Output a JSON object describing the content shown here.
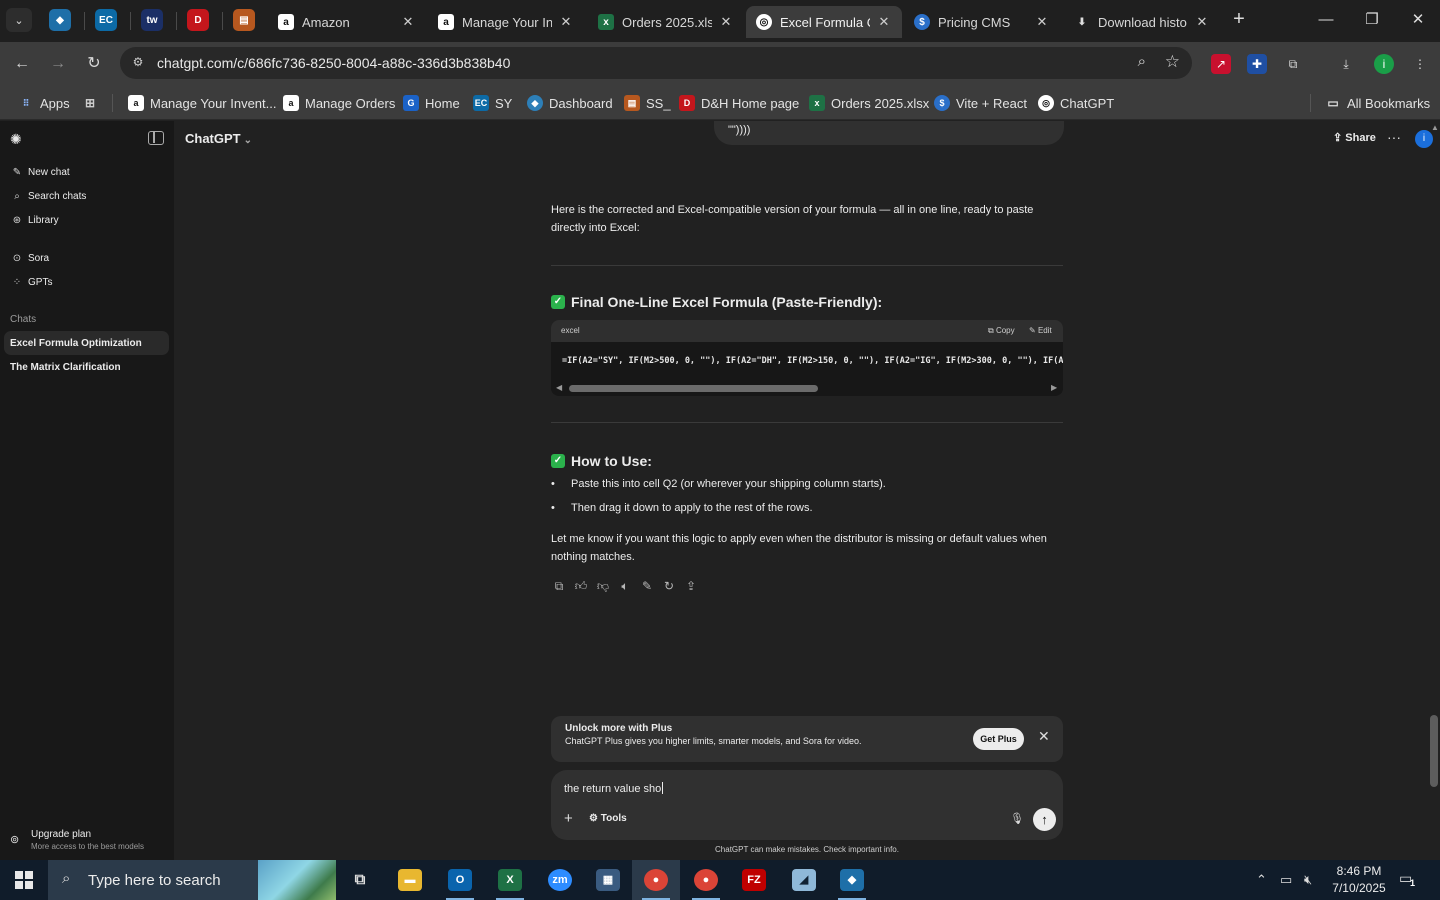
{
  "browser": {
    "tabs": [
      {
        "label": "Amazon"
      },
      {
        "label": "Manage Your In"
      },
      {
        "label": "Orders 2025.xlsx"
      },
      {
        "label": "Excel Formula O"
      },
      {
        "label": "Pricing CMS"
      },
      {
        "label": "Download histo"
      }
    ],
    "url": "chatgpt.com/c/686fc736-8250-8004-a88c-336d3b838b40",
    "bookmarks": [
      {
        "label": "Apps"
      },
      {
        "label": "Manage Your Invent..."
      },
      {
        "label": "Manage Orders"
      },
      {
        "label": "Home"
      },
      {
        "label": "SY"
      },
      {
        "label": "Dashboard"
      },
      {
        "label": "SS_"
      },
      {
        "label": "D&H Home page"
      },
      {
        "label": "Orders 2025.xlsx"
      },
      {
        "label": "Vite + React"
      },
      {
        "label": "ChatGPT"
      }
    ],
    "all_bookmarks": "All Bookmarks",
    "profile_initial": "i"
  },
  "sidebar": {
    "nav": [
      {
        "label": "New chat",
        "icon": "edit-icon"
      },
      {
        "label": "Search chats",
        "icon": "search-icon"
      },
      {
        "label": "Library",
        "icon": "library-icon"
      },
      {
        "label": "Sora",
        "icon": "play-circle-icon"
      },
      {
        "label": "GPTs",
        "icon": "grid-icon"
      }
    ],
    "chats_heading": "Chats",
    "chats": [
      {
        "label": "Excel Formula Optimization",
        "active": true
      },
      {
        "label": "The Matrix Clarification",
        "active": false
      }
    ],
    "upgrade_title": "Upgrade plan",
    "upgrade_sub": "More access to the best models"
  },
  "header": {
    "model": "ChatGPT",
    "share": "Share",
    "avatar_initial": "i"
  },
  "conversation": {
    "user_tail": "\"\"))))",
    "intro": "Here is the corrected and Excel-compatible version of your formula — all in one line, ready to paste directly into Excel:",
    "section1_title": "Final One-Line Excel Formula (Paste-Friendly):",
    "code_lang": "excel",
    "code_copy": "Copy",
    "code_edit": "Edit",
    "code": "=IF(A2=\"SY\", IF(M2>500, 0, \"\"), IF(A2=\"DH\", IF(M2>150, 0, \"\"), IF(A2=\"IG\", IF(M2>300, 0, \"\"), IF(A",
    "section2_title": "How to Use:",
    "steps": [
      "Paste this into cell Q2 (or wherever your shipping column starts).",
      "Then drag it down to apply to the rest of the rows."
    ],
    "closing": "Let me know if you want this logic to apply even when the distributor is missing or default values when nothing matches."
  },
  "banner": {
    "title": "Unlock more with Plus",
    "body": "ChatGPT Plus gives you higher limits, smarter models, and Sora for video.",
    "button": "Get Plus"
  },
  "composer": {
    "text": "the return value sho",
    "tools": "Tools"
  },
  "disclaimer": "ChatGPT can make mistakes. Check important info.",
  "taskbar": {
    "search_placeholder": "Type here to search",
    "time": "8:46 PM",
    "date": "7/10/2025",
    "notifications": "1"
  }
}
